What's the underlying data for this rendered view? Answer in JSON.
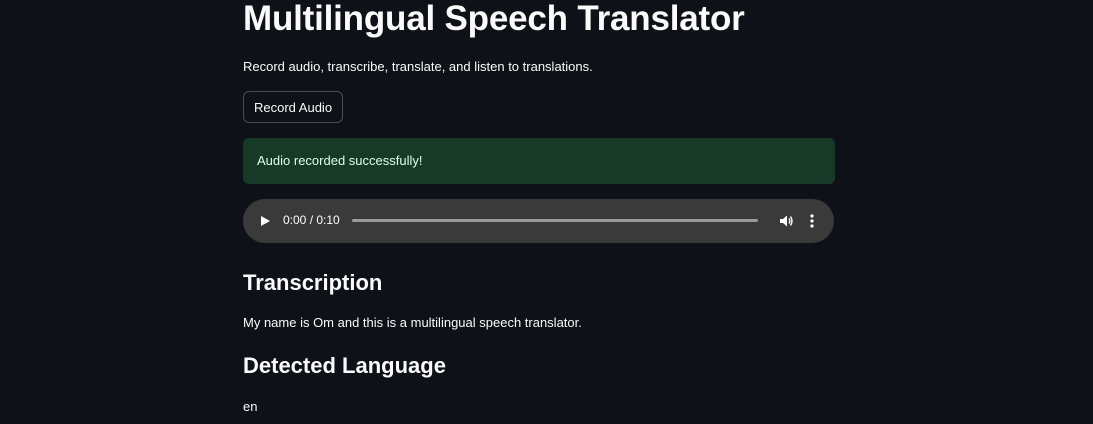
{
  "page": {
    "title": "Multilingual Speech Translator",
    "subtitle": "Record audio, transcribe, translate, and listen to translations."
  },
  "record_button": {
    "label": "Record Audio"
  },
  "alert": {
    "message": "Audio recorded successfully!"
  },
  "audio_player": {
    "time_display": "0:00 / 0:10",
    "progress": 0,
    "play_icon": "play-icon",
    "volume_icon": "volume-icon",
    "more_icon": "more-options-icon"
  },
  "transcription": {
    "heading": "Transcription",
    "text": "My name is Om and this is a multilingual speech translator."
  },
  "detected_language": {
    "heading": "Detected Language",
    "value": "en"
  },
  "colors": {
    "background": "#0e1117",
    "success_bg": "#173928",
    "success_text": "#dffde9",
    "player_bg": "#3a3a3a"
  }
}
